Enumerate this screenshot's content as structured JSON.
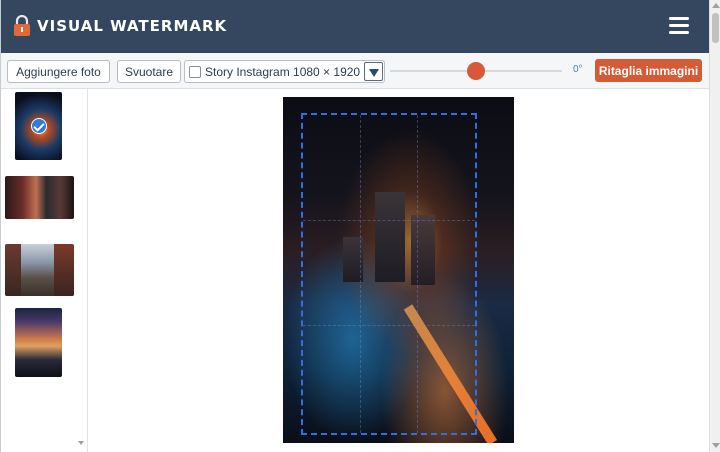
{
  "header": {
    "brand": "VISUAL WATERMARK",
    "logo_icon": "padlock-icon",
    "menu_icon": "hamburger-menu-icon"
  },
  "toolbar": {
    "add_photos_label": "Aggiungere foto",
    "clear_label": "Svuotare",
    "preset": {
      "checked": false,
      "selected": "Story Instagram 1080 × 1920"
    },
    "rotation": {
      "value_label": "0°"
    },
    "crop_button_label": "Ritaglia immagini"
  },
  "thumbnails": [
    {
      "name": "night city aerial",
      "selected": true
    },
    {
      "name": "city street sunset",
      "selected": false
    },
    {
      "name": "manhattan bridge",
      "selected": false
    },
    {
      "name": "city skyline sunset",
      "selected": false
    }
  ],
  "colors": {
    "header_bg": "#34475e",
    "accent": "#d35b35",
    "crop_frame": "#2f6fe0",
    "check_badge": "#2f7bd6"
  }
}
